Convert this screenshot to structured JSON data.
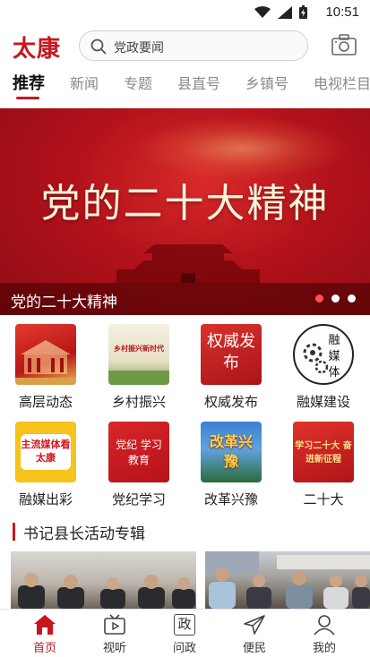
{
  "status_bar": {
    "time": "10:51"
  },
  "header": {
    "logo": "太康",
    "search_text": "党政要闻"
  },
  "tabs": [
    {
      "label": "推荐",
      "active": true
    },
    {
      "label": "新闻"
    },
    {
      "label": "专题"
    },
    {
      "label": "县直号"
    },
    {
      "label": "乡镇号"
    },
    {
      "label": "电视栏目"
    }
  ],
  "banner": {
    "headline": "党的二十大精神",
    "caption": "党的二十大精神",
    "dots": 3,
    "active_dot": 0
  },
  "grid": [
    {
      "label": "高层动态",
      "thumb_text": ""
    },
    {
      "label": "乡村振兴",
      "thumb_text": "乡村振兴新时代"
    },
    {
      "label": "权威发布",
      "thumb_text": "权威发布"
    },
    {
      "label": "融媒建设",
      "thumb_text": "融媒体"
    },
    {
      "label": "融媒出彩",
      "thumb_text": "主流媒体看太康"
    },
    {
      "label": "党纪学习",
      "thumb_text": "党纪 学习教育"
    },
    {
      "label": "改革兴豫",
      "thumb_text": "改革兴豫"
    },
    {
      "label": "二十大",
      "thumb_text": "学习二十大 奋进新征程"
    }
  ],
  "section": {
    "title": "书记县长活动专辑"
  },
  "bottom_nav": [
    {
      "label": "首页",
      "icon": "home-icon",
      "active": true
    },
    {
      "label": "视听",
      "icon": "video-icon"
    },
    {
      "label": "问政",
      "icon": "government-icon",
      "glyph": "政"
    },
    {
      "label": "便民",
      "icon": "send-icon"
    },
    {
      "label": "我的",
      "icon": "user-icon"
    }
  ],
  "colors": {
    "brand": "#c8161d",
    "banner": "#b3121b"
  }
}
